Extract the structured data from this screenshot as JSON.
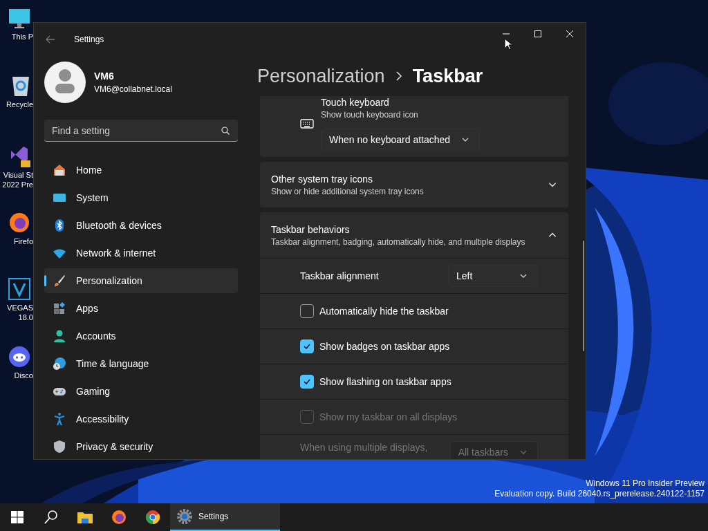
{
  "desktop_icons": [
    {
      "kind": "monitor",
      "lines": [
        "This P"
      ]
    },
    {
      "kind": "recycle",
      "lines": [
        "Recycle"
      ]
    },
    {
      "kind": "studio",
      "lines": [
        "Visual St",
        "2022 Pre"
      ]
    },
    {
      "kind": "firefox",
      "lines": [
        "Firefo"
      ]
    },
    {
      "kind": "vegas",
      "lines": [
        "VEGAS",
        "18.0"
      ]
    },
    {
      "kind": "discord",
      "lines": [
        "Disco"
      ]
    }
  ],
  "window": {
    "title": "Settings",
    "user": {
      "name": "VM6",
      "email": "VM6@collabnet.local"
    },
    "search": {
      "placeholder": "Find a setting"
    },
    "nav": [
      {
        "kind": "home",
        "label": "Home",
        "selected": false
      },
      {
        "kind": "system",
        "label": "System",
        "selected": false
      },
      {
        "kind": "bluetooth",
        "label": "Bluetooth & devices",
        "selected": false
      },
      {
        "kind": "network",
        "label": "Network & internet",
        "selected": false
      },
      {
        "kind": "personalization",
        "label": "Personalization",
        "selected": true
      },
      {
        "kind": "apps",
        "label": "Apps",
        "selected": false
      },
      {
        "kind": "accounts",
        "label": "Accounts",
        "selected": false
      },
      {
        "kind": "time",
        "label": "Time & language",
        "selected": false
      },
      {
        "kind": "gaming",
        "label": "Gaming",
        "selected": false
      },
      {
        "kind": "accessibility",
        "label": "Accessibility",
        "selected": false
      },
      {
        "kind": "privacy",
        "label": "Privacy & security",
        "selected": false
      }
    ],
    "breadcrumb": [
      "Personalization",
      "Taskbar"
    ],
    "cards": [
      {
        "kind": "dropdown_card",
        "title": "Touch keyboard",
        "subtitle": "Show touch keyboard icon",
        "value": "When no keyboard attached"
      },
      {
        "kind": "expander",
        "title": "Other system tray icons",
        "subtitle": "Show or hide additional system tray icons",
        "expanded": false
      },
      {
        "kind": "expander",
        "title": "Taskbar behaviors",
        "subtitle": "Taskbar alignment, badging, automatically hide, and multiple displays",
        "expanded": true,
        "rows": [
          {
            "kind": "dropdown",
            "label": "Taskbar alignment",
            "value": "Left",
            "disabled": false
          },
          {
            "kind": "checkbox",
            "label": "Automatically hide the taskbar",
            "checked": false,
            "disabled": false
          },
          {
            "kind": "checkbox",
            "label": "Show badges on taskbar apps",
            "checked": true,
            "disabled": false
          },
          {
            "kind": "checkbox",
            "label": "Show flashing on taskbar apps",
            "checked": true,
            "disabled": false
          },
          {
            "kind": "checkbox",
            "label": "Show my taskbar on all displays",
            "checked": false,
            "disabled": true
          },
          {
            "kind": "dropdown",
            "label": "When using multiple displays,",
            "value": "All taskbars",
            "disabled": true
          }
        ]
      }
    ]
  },
  "desktop_notice": [
    "Windows 11 Pro Insider Preview",
    "Evaluation copy. Build 26040.rs_prerelease.240122-1157"
  ],
  "taskbar": [
    {
      "kind": "start",
      "selected": false
    },
    {
      "kind": "search",
      "selected": false
    },
    {
      "kind": "explorer",
      "selected": false
    },
    {
      "kind": "firefox",
      "selected": false
    },
    {
      "kind": "chrome",
      "selected": false
    },
    {
      "kind": "settings",
      "label": "Settings",
      "selected": true
    }
  ]
}
